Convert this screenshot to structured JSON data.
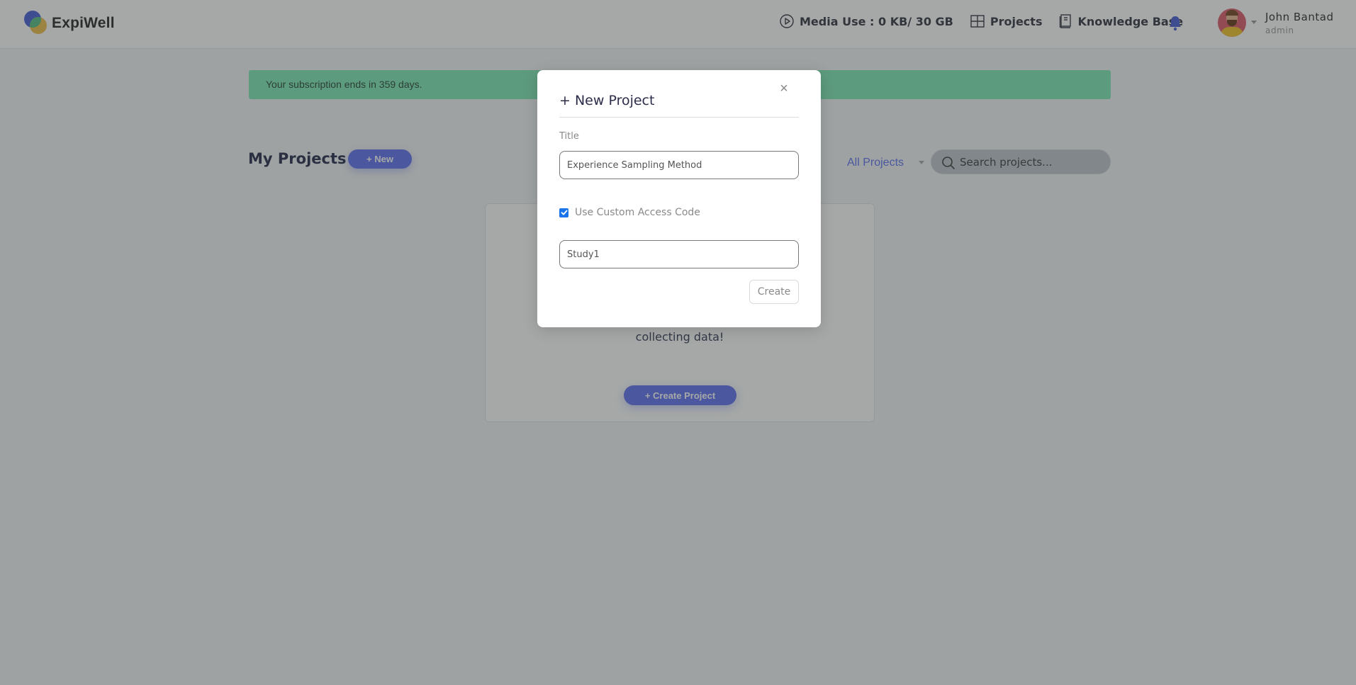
{
  "app": {
    "name": "ExpiWell"
  },
  "header": {
    "media_use_label": "Media Use : 0 KB/ 30 GB",
    "nav": [
      {
        "label": "Projects",
        "icon": "grid-icon"
      },
      {
        "label": "Knowledge Base",
        "icon": "book-icon"
      }
    ],
    "notification_icon": "bell-icon",
    "user": {
      "name": "John Bantad",
      "role": "admin"
    }
  },
  "banner": {
    "text": "Your subscription ends in 359 days."
  },
  "main": {
    "title": "My Projects",
    "new_button": "+ New",
    "filter_selected": "All Projects",
    "search_placeholder": "Search projects...",
    "empty_state": {
      "text": "collecting data!",
      "create_button": "+ Create Project"
    }
  },
  "modal": {
    "title": "+ New Project",
    "close_icon": "×",
    "title_label": "Title",
    "title_value": "Experience Sampling Method",
    "custom_code_label": "Use Custom Access Code",
    "custom_code_checked": true,
    "access_code_value": "Study1",
    "create_button": "Create"
  },
  "colors": {
    "accent": "#6474f0",
    "banner": "#84e8b8",
    "checkbox": "#1a73e8",
    "bell": "#4f63d7"
  }
}
